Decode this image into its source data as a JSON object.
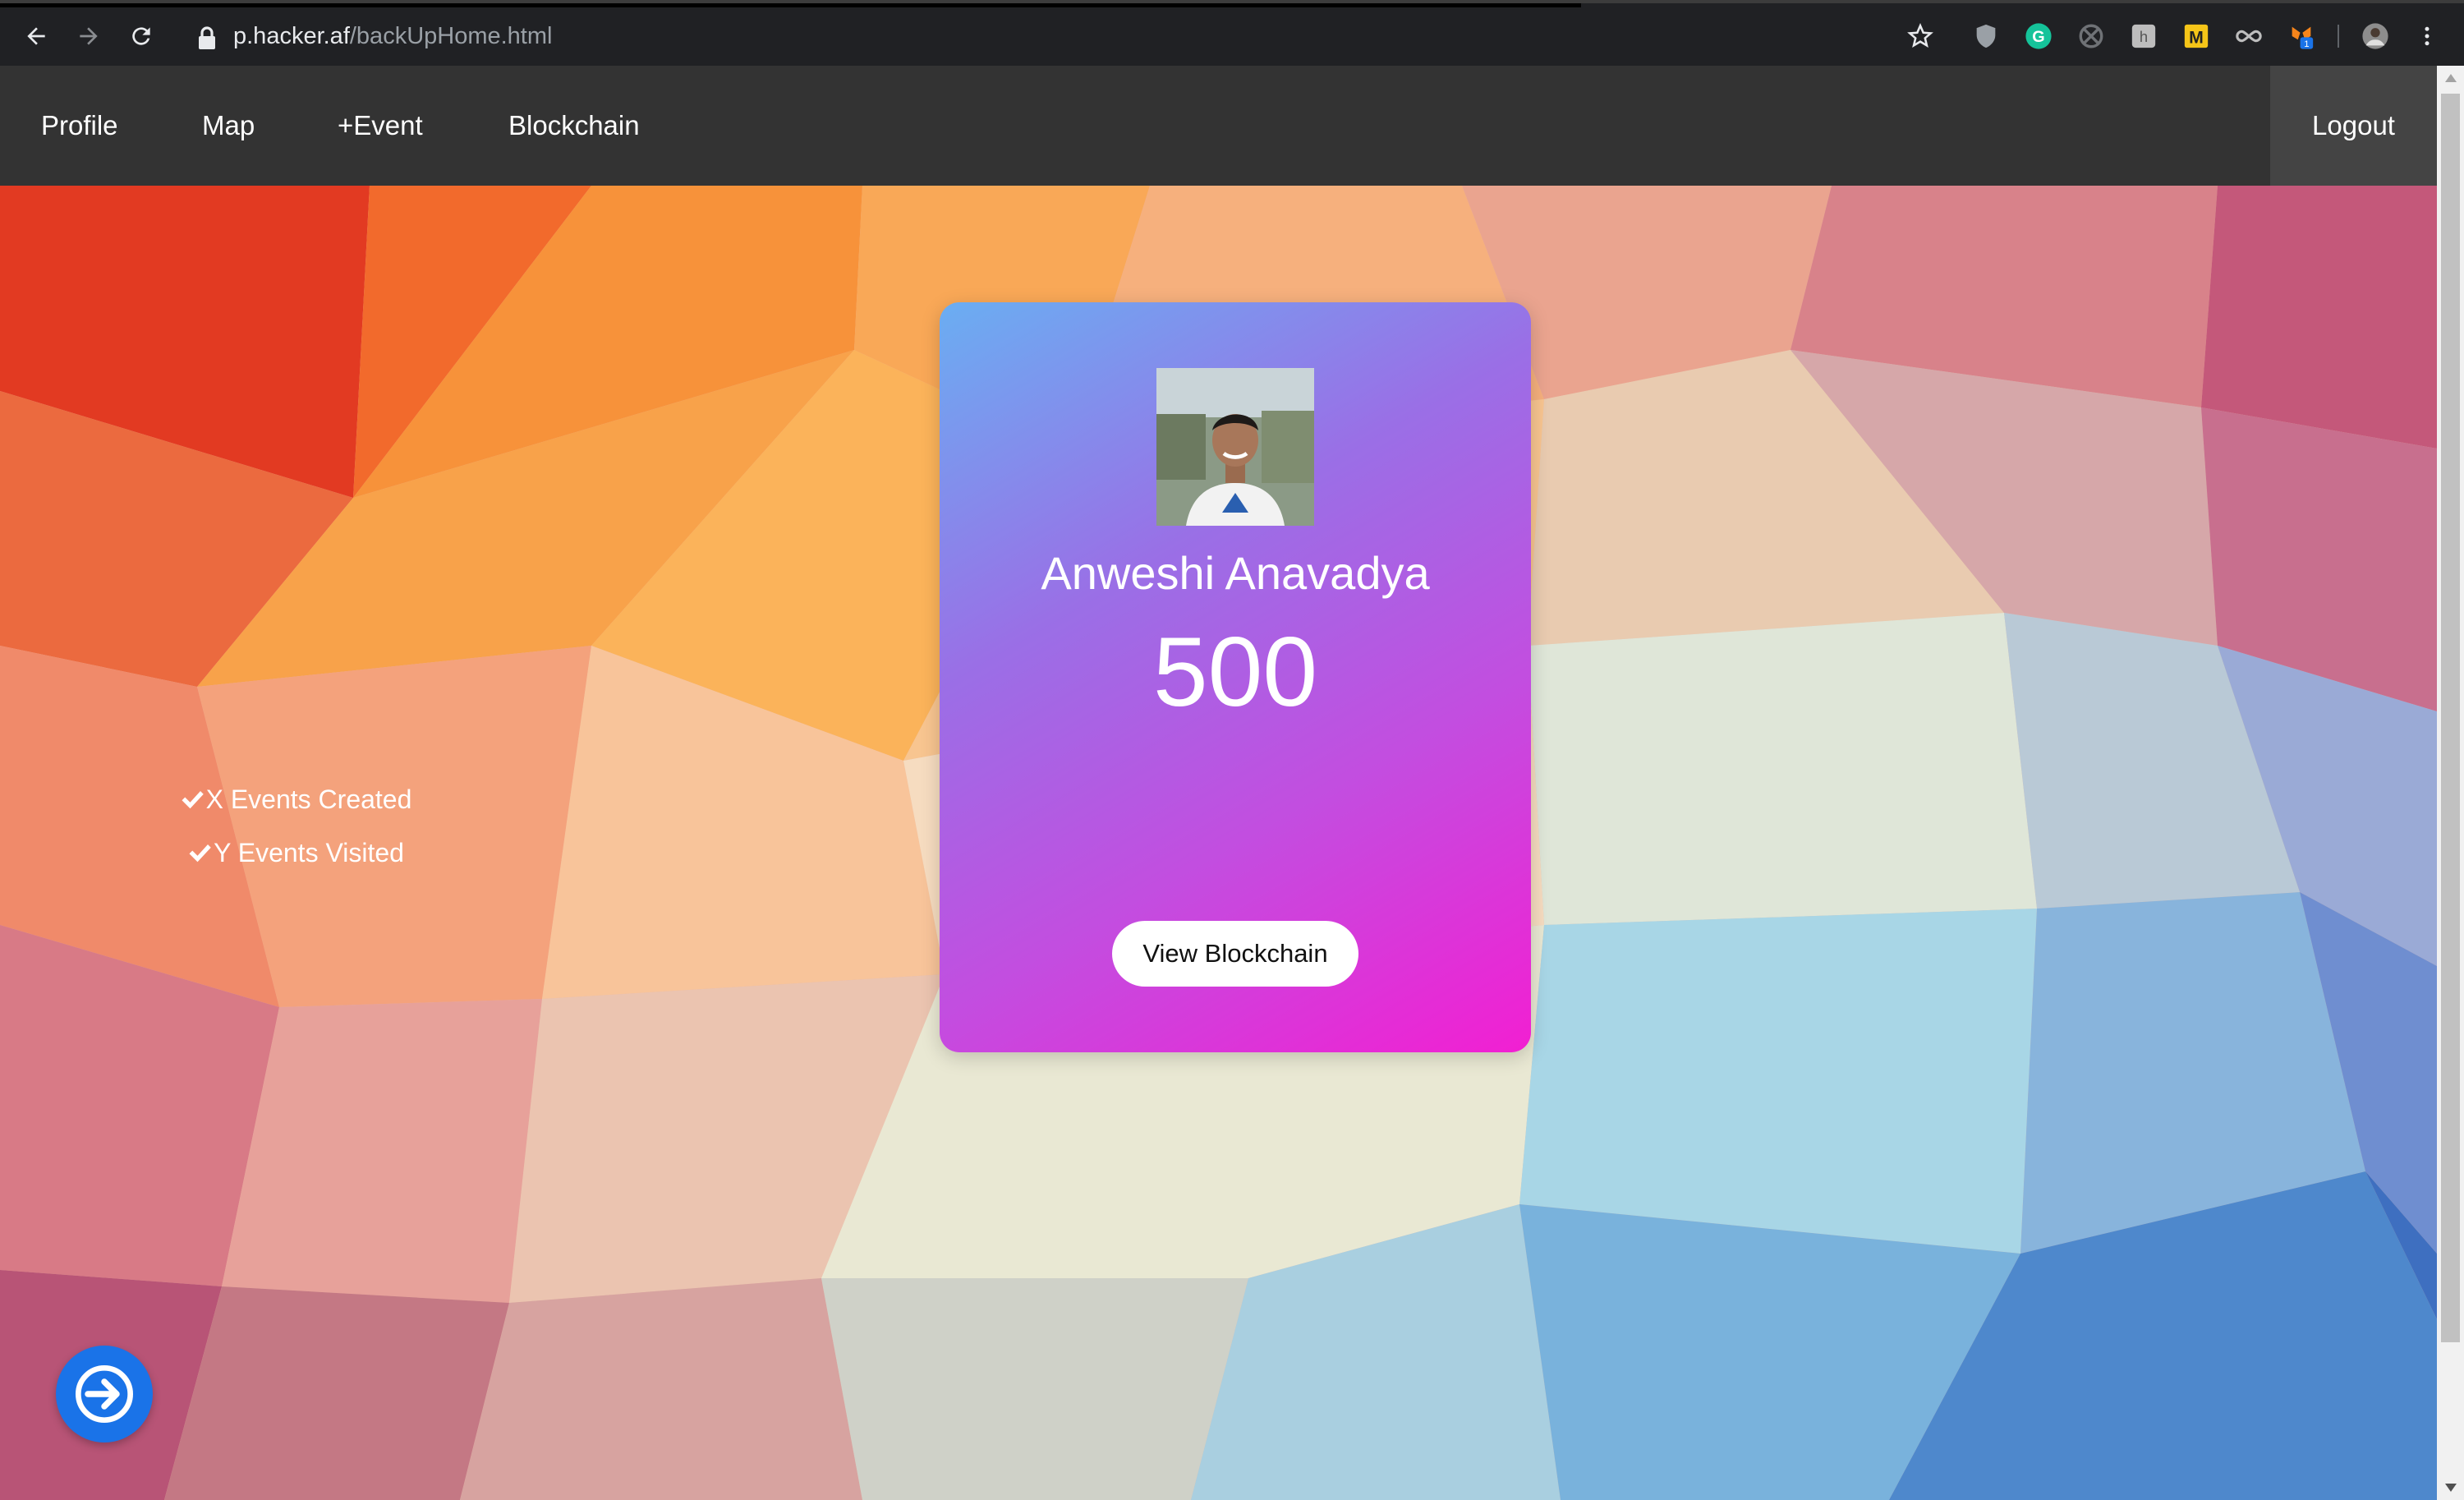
{
  "browser": {
    "url_host": "p.hacker.af",
    "url_path": "/backUpHome.html",
    "extensions": [
      "star-icon",
      "shield-icon",
      "grammarly-icon",
      "crossed-circle-icon",
      "puzzle-extension-icon",
      "m-extension-icon",
      "infinity-icon",
      "metamask-icon",
      "user-avatar-icon",
      "kebab-menu-icon"
    ],
    "badge_count": "1"
  },
  "nav": {
    "links": [
      {
        "label": "Profile"
      },
      {
        "label": "Map"
      },
      {
        "label": "+Event"
      },
      {
        "label": "Blockchain"
      }
    ],
    "logout_label": "Logout"
  },
  "card": {
    "name": "Anweshi Anavadya",
    "points": "500",
    "events_created": "X Events Created",
    "events_visited": "Y Events Visited",
    "button_label": "View Blockchain"
  },
  "colors": {
    "navbar": "#333333",
    "logout_bg": "#444444",
    "card_gradient_start": "#6aaef2",
    "card_gradient_end": "#f21fd2",
    "fab": "#1a73e8"
  }
}
